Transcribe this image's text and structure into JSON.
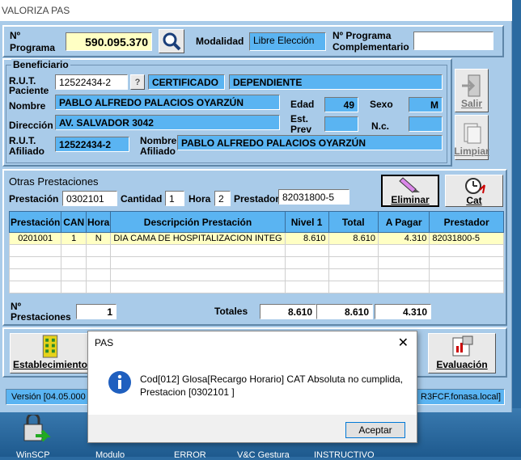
{
  "window": {
    "title": "VALORIZA PAS"
  },
  "programa": {
    "label_n": "Nº",
    "label_programa": "Programa",
    "value": "590.095.370",
    "modalidad_label": "Modalidad",
    "modalidad_value": "Libre Elección",
    "complementario_label_1": "Nº Programa",
    "complementario_label_2": "Complementario",
    "complementario_value": ""
  },
  "beneficiario": {
    "group_title": "Beneficiario",
    "rut_label_1": "R.U.T.",
    "rut_label_2": "Paciente",
    "rut_value": "12522434-2",
    "help_button": "?",
    "certificado": "CERTIFICADO",
    "tipo": "DEPENDIENTE",
    "nombre_label": "Nombre",
    "nombre_value": "PABLO ALFREDO PALACIOS OYARZÚN",
    "edad_label": "Edad",
    "edad_value": "49",
    "sexo_label": "Sexo",
    "sexo_value": "M",
    "direccion_label": "Dirección",
    "direccion_value": "AV. SALVADOR 3042",
    "estprev_label_1": "Est.",
    "estprev_label_2": "Prev",
    "estprev_value": "",
    "nc_label": "N.c.",
    "nc_value": "",
    "rut_afiliado_label_1": "R.U.T.",
    "rut_afiliado_label_2": "Afiliado",
    "rut_afiliado_value": "12522434-2",
    "nombre_afiliado_label_1": "Nombre",
    "nombre_afiliado_label_2": "Afiliado",
    "nombre_afiliado_value": "PABLO ALFREDO PALACIOS OYARZÚN"
  },
  "side_buttons": {
    "salir": "Salir",
    "limpiar": "Limpiar"
  },
  "prestaciones": {
    "title": "Otras Prestaciones",
    "prestacion_label": "Prestación",
    "prestacion_value": "0302101",
    "cantidad_label": "Cantidad",
    "cantidad_value": "1",
    "hora_label": "Hora",
    "hora_value": "2",
    "prestador_label": "Prestador",
    "prestador_value": "82031800-5",
    "eliminar_button": "Eliminar",
    "cat_button": "Cat",
    "columns": [
      "Prestación",
      "CAN",
      "Hora",
      "Descripción Prestación",
      "Nivel 1",
      "Total",
      "A Pagar",
      "Prestador"
    ],
    "rows": [
      [
        "0201001",
        "1",
        "N",
        "DIA CAMA DE HOSPITALIZACION INTEG",
        "8.610",
        "8.610",
        "4.310",
        "82031800-5"
      ]
    ],
    "n_label_1": "Nº",
    "n_label_2": "Prestaciones",
    "n_value": "1",
    "totales_label": "Totales",
    "total_nivel1": "8.610",
    "total_total": "8.610",
    "total_pagar": "4.310"
  },
  "bottom_buttons": {
    "establecimiento": "Establecimiento",
    "evaluacion": "Evaluación"
  },
  "status_bar": {
    "left": "Versión [04.05.000",
    "right": "R3FCF.fonasa.local]"
  },
  "dialog": {
    "title": "PAS",
    "close": "✕",
    "message_line1": "Cod[012] Glosa[Recargo Horario] CAT Absoluta  no cumplida,",
    "message_line2": "Prestacion [0302101 ]",
    "ok_button": "Aceptar"
  },
  "desktop": {
    "labels": [
      "WinSCP",
      "Modulo",
      "ERROR",
      "V&C Gestura",
      "INSTRUCTIVO"
    ]
  },
  "colors": {
    "window_bg": "#a9cbe9",
    "field_blue": "#5ab4f2",
    "field_yellow": "#ffffc4"
  }
}
